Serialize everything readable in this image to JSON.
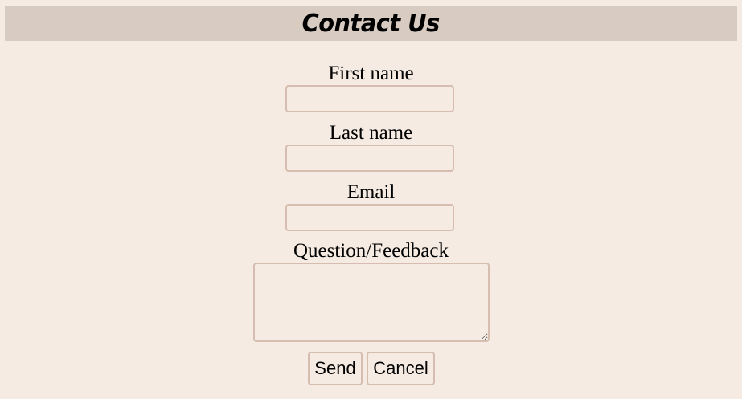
{
  "header": {
    "title": "Contact Us"
  },
  "form": {
    "first_name": {
      "label": "First name",
      "value": "",
      "placeholder": ""
    },
    "last_name": {
      "label": "Last name",
      "value": "",
      "placeholder": ""
    },
    "email": {
      "label": "Email",
      "value": "",
      "placeholder": ""
    },
    "feedback": {
      "label": "Question/Feedback",
      "value": "",
      "placeholder": ""
    }
  },
  "actions": {
    "send_label": "Send",
    "cancel_label": "Cancel"
  },
  "colors": {
    "page_background": "#f5ebe2",
    "header_background": "#d8cbc1",
    "field_border": "#d6bdb0"
  }
}
